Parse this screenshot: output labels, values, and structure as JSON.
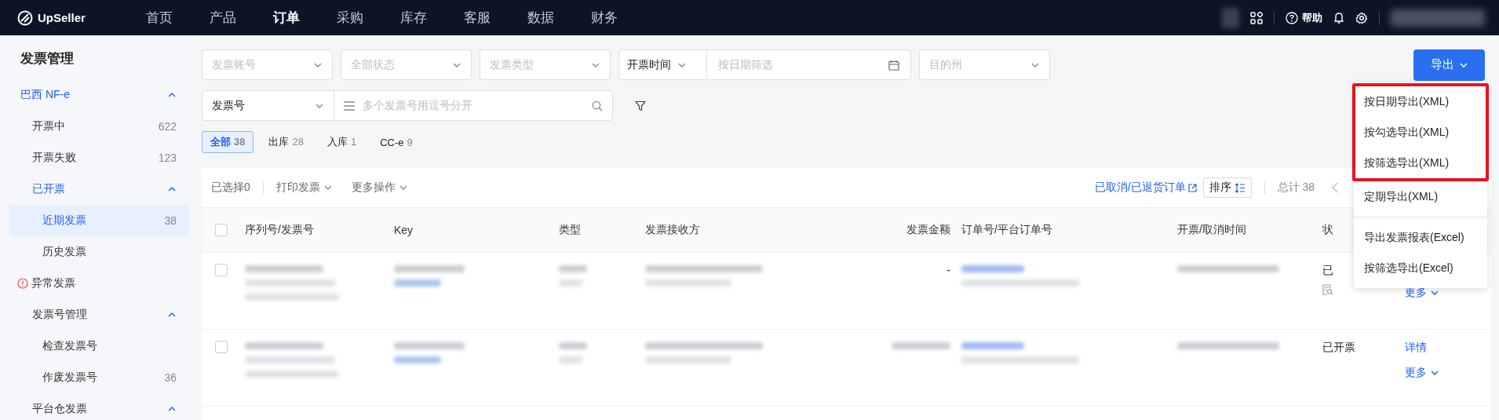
{
  "topbar": {
    "logo": "UpSeller",
    "nav": [
      {
        "label": "首页",
        "selected": false
      },
      {
        "label": "产品",
        "selected": false
      },
      {
        "label": "订单",
        "selected": true
      },
      {
        "label": "采购",
        "selected": false
      },
      {
        "label": "库存",
        "selected": false
      },
      {
        "label": "客服",
        "selected": false
      },
      {
        "label": "数据",
        "selected": false
      },
      {
        "label": "财务",
        "selected": false
      }
    ],
    "help": "帮助"
  },
  "sidebar": {
    "title": "发票管理",
    "items": [
      {
        "label": "巴西 NF-e",
        "kind": "section",
        "expanded": true,
        "children": [
          {
            "label": "开票中",
            "count": "622",
            "selected": false
          },
          {
            "label": "开票失败",
            "count": "123",
            "selected": false
          },
          {
            "label": "已开票",
            "expanded": true,
            "children": [
              {
                "label": "近期发票",
                "count": "38",
                "selected": true
              },
              {
                "label": "历史发票",
                "selected": false
              }
            ]
          }
        ]
      },
      {
        "label": "异常发票",
        "kind": "alert"
      },
      {
        "label": "发票号管理",
        "kind": "group",
        "expanded": true,
        "children": [
          {
            "label": "检查发票号",
            "selected": false
          },
          {
            "label": "作废发票号",
            "count": "36",
            "selected": false
          }
        ]
      },
      {
        "label": "平台仓发票",
        "kind": "group",
        "expanded": true
      }
    ]
  },
  "filters": {
    "row1": [
      {
        "kind": "select",
        "placeholder": "发票账号"
      },
      {
        "kind": "select",
        "placeholder": "全部状态"
      },
      {
        "kind": "select",
        "placeholder": "发票类型"
      },
      {
        "kind": "date",
        "select": "开票时间",
        "placeholder": "按日期筛选"
      },
      {
        "kind": "select",
        "placeholder": "目的州"
      }
    ],
    "row2": {
      "select": "发票号",
      "placeholder": "多个发票号用逗号分开"
    }
  },
  "export_button": "导出",
  "tabs": [
    {
      "label": "全部",
      "count": "38",
      "selected": true
    },
    {
      "label": "出库",
      "count": "28",
      "selected": false
    },
    {
      "label": "入库",
      "count": "1",
      "selected": false
    },
    {
      "label": "CC-e",
      "count": "9",
      "selected": false
    }
  ],
  "toolbar": {
    "selected_count": "已选择0",
    "actions": [
      "打印发票",
      "更多操作"
    ],
    "link": "已取消/已退货订单",
    "sort": "排序",
    "total": "总计 38"
  },
  "table": {
    "columns": [
      "序列号/发票号",
      "Key",
      "类型",
      "发票接收方",
      "发票金额",
      "订单号/平台订单号",
      "开票/取消时间",
      "状"
    ],
    "header_checked": false,
    "rows": [
      {
        "checked": false,
        "amount": "-",
        "status": "已",
        "status_icon": true,
        "actions": [
          "更多"
        ]
      },
      {
        "checked": false,
        "status": "已开票",
        "actions": [
          "详情",
          "更多"
        ]
      }
    ]
  },
  "export_menu": {
    "sections": [
      [
        {
          "label": "按日期导出(XML)",
          "callout": true
        },
        {
          "label": "按勾选导出(XML)",
          "callout": true
        },
        {
          "label": "按筛选导出(XML)",
          "callout": true
        },
        {
          "label": "定期导出(XML)",
          "callout": false
        }
      ],
      [
        {
          "label": "导出发票报表(Excel)",
          "callout": false
        },
        {
          "label": "按筛选导出(Excel)",
          "callout": false
        }
      ]
    ]
  }
}
